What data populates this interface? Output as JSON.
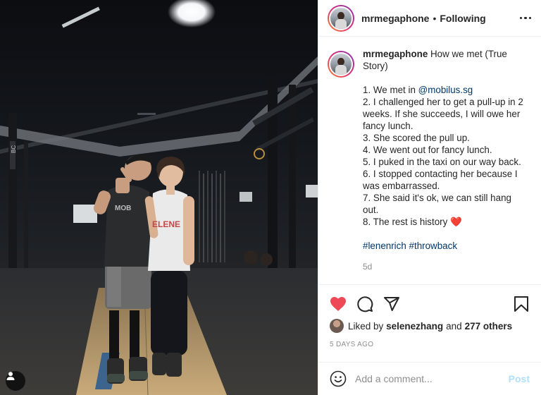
{
  "post": {
    "photo": {
      "alt_icons": {
        "tag": "user-tag-icon"
      },
      "shirt_text_left": "MOB",
      "shirt_text_right": "ELENE",
      "wall_text": "BC"
    },
    "header": {
      "username": "mrmegaphone",
      "separator": "•",
      "follow_status": "Following"
    },
    "caption": {
      "username": "mrmegaphone",
      "first_line": "How we met (True Story)",
      "item1_prefix": "1. We met in ",
      "item1_mention": "@mobilus.sg",
      "item2": "2. I challenged her to get a pull-up in 2 weeks. If she succeeds, I will owe her fancy lunch.",
      "item3": "3. She scored the pull up.",
      "item4": "4. We went out for fancy lunch.",
      "item5": "5. I puked in the taxi on our way back.",
      "item6": "6. I stopped contacting her because I was embarrassed.",
      "item7": "7. She said it's ok, we can still hang out.",
      "item8": "8. The rest is history",
      "heart": "❤️",
      "hashtag1": "#lenenrich",
      "hashtag2": "#throwback",
      "time_ago": "5d"
    },
    "actions": {
      "icons": [
        "heart-filled-icon",
        "comment-icon",
        "share-icon",
        "bookmark-icon"
      ],
      "like_color": "#ed4956"
    },
    "likes": {
      "prefix": "Liked by",
      "liker": "selenezhang",
      "conjunction": "and",
      "others": "277 others"
    },
    "date": "5 DAYS AGO",
    "comment_box": {
      "placeholder": "Add a comment...",
      "post_label": "Post"
    }
  }
}
